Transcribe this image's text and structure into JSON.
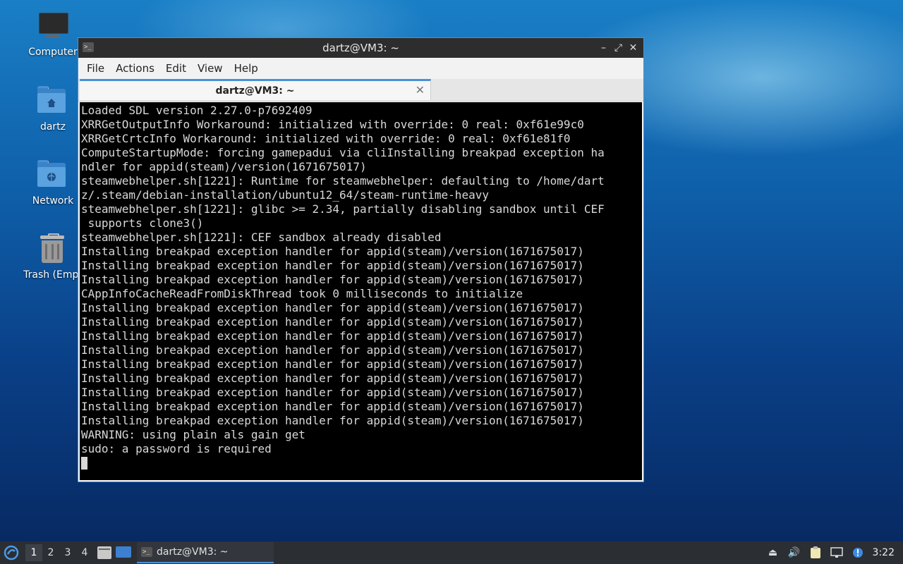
{
  "desktop": {
    "icons": [
      {
        "label": "Computer"
      },
      {
        "label": "dartz"
      },
      {
        "label": "Network"
      },
      {
        "label": "Trash (Empt"
      }
    ]
  },
  "window": {
    "title": "dartz@VM3: ~",
    "title_icon": ">_",
    "controls": {
      "minimize": "–",
      "maximize": "⤢",
      "close": "✕"
    },
    "menu": [
      "File",
      "Actions",
      "Edit",
      "View",
      "Help"
    ],
    "tab": {
      "label": "dartz@VM3: ~",
      "close": "✕"
    }
  },
  "terminal": {
    "lines": [
      "Loaded SDL version 2.27.0-p7692409",
      "XRRGetOutputInfo Workaround: initialized with override: 0 real: 0xf61e99c0",
      "XRRGetCrtcInfo Workaround: initialized with override: 0 real: 0xf61e81f0",
      "ComputeStartupMode: forcing gamepadui via cliInstalling breakpad exception ha",
      "ndler for appid(steam)/version(1671675017)",
      "steamwebhelper.sh[1221]: Runtime for steamwebhelper: defaulting to /home/dart",
      "z/.steam/debian-installation/ubuntu12_64/steam-runtime-heavy",
      "steamwebhelper.sh[1221]: glibc >= 2.34, partially disabling sandbox until CEF",
      " supports clone3()",
      "steamwebhelper.sh[1221]: CEF sandbox already disabled",
      "Installing breakpad exception handler for appid(steam)/version(1671675017)",
      "Installing breakpad exception handler for appid(steam)/version(1671675017)",
      "Installing breakpad exception handler for appid(steam)/version(1671675017)",
      "CAppInfoCacheReadFromDiskThread took 0 milliseconds to initialize",
      "Installing breakpad exception handler for appid(steam)/version(1671675017)",
      "Installing breakpad exception handler for appid(steam)/version(1671675017)",
      "Installing breakpad exception handler for appid(steam)/version(1671675017)",
      "Installing breakpad exception handler for appid(steam)/version(1671675017)",
      "Installing breakpad exception handler for appid(steam)/version(1671675017)",
      "Installing breakpad exception handler for appid(steam)/version(1671675017)",
      "Installing breakpad exception handler for appid(steam)/version(1671675017)",
      "Installing breakpad exception handler for appid(steam)/version(1671675017)",
      "Installing breakpad exception handler for appid(steam)/version(1671675017)",
      "WARNING: using plain als gain get",
      "sudo: a password is required"
    ]
  },
  "taskbar": {
    "workspaces": [
      "1",
      "2",
      "3",
      "4"
    ],
    "task_label": "dartz@VM3: ~",
    "task_icon": ">_",
    "clock": "3:22"
  },
  "colors": {
    "accent": "#4a90d9",
    "terminal_bg": "#000000",
    "terminal_fg": "#d8d8d8",
    "titlebar": "#2d2d2d",
    "taskbar": "#2b2e33"
  }
}
